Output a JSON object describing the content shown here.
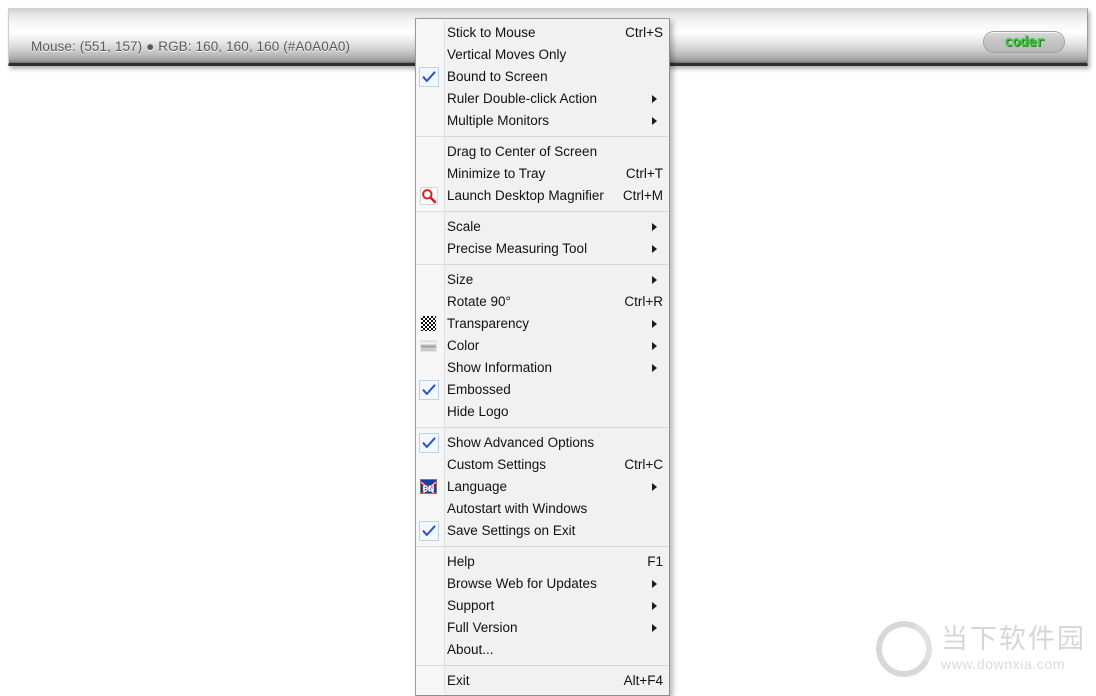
{
  "ruler": {
    "readout": "Mouse: (551, 157) ● RGB: 160, 160, 160 (#A0A0A0)",
    "logo_text": "coder"
  },
  "menu": {
    "groups": [
      {
        "items": [
          {
            "label": "Stick to Mouse",
            "shortcut": "Ctrl+S",
            "checked": false,
            "submenu": false,
            "icon": ""
          },
          {
            "label": "Vertical Moves Only",
            "shortcut": "",
            "checked": false,
            "submenu": false,
            "icon": ""
          },
          {
            "label": "Bound to Screen",
            "shortcut": "",
            "checked": true,
            "submenu": false,
            "icon": ""
          },
          {
            "label": "Ruler Double-click Action",
            "shortcut": "",
            "checked": false,
            "submenu": true,
            "icon": ""
          },
          {
            "label": "Multiple Monitors",
            "shortcut": "",
            "checked": false,
            "submenu": true,
            "icon": ""
          }
        ]
      },
      {
        "items": [
          {
            "label": "Drag to Center of Screen",
            "shortcut": "",
            "checked": false,
            "submenu": false,
            "icon": ""
          },
          {
            "label": "Minimize to Tray",
            "shortcut": "Ctrl+T",
            "checked": false,
            "submenu": false,
            "icon": ""
          },
          {
            "label": "Launch Desktop Magnifier",
            "shortcut": "Ctrl+M",
            "checked": false,
            "submenu": false,
            "icon": "magnifier-icon"
          }
        ]
      },
      {
        "items": [
          {
            "label": "Scale",
            "shortcut": "",
            "checked": false,
            "submenu": true,
            "icon": ""
          },
          {
            "label": "Precise Measuring Tool",
            "shortcut": "",
            "checked": false,
            "submenu": true,
            "icon": ""
          }
        ]
      },
      {
        "items": [
          {
            "label": "Size",
            "shortcut": "",
            "checked": false,
            "submenu": true,
            "icon": ""
          },
          {
            "label": "Rotate 90°",
            "shortcut": "Ctrl+R",
            "checked": false,
            "submenu": false,
            "icon": ""
          },
          {
            "label": "Transparency",
            "shortcut": "",
            "checked": false,
            "submenu": true,
            "icon": "transparency-icon"
          },
          {
            "label": "Color",
            "shortcut": "",
            "checked": false,
            "submenu": true,
            "icon": "color-gradient-icon"
          },
          {
            "label": "Show Information",
            "shortcut": "",
            "checked": false,
            "submenu": true,
            "icon": ""
          },
          {
            "label": "Embossed",
            "shortcut": "",
            "checked": true,
            "submenu": false,
            "icon": ""
          },
          {
            "label": "Hide Logo",
            "shortcut": "",
            "checked": false,
            "submenu": false,
            "icon": ""
          }
        ]
      },
      {
        "items": [
          {
            "label": "Show Advanced Options",
            "shortcut": "",
            "checked": true,
            "submenu": false,
            "icon": ""
          },
          {
            "label": "Custom Settings",
            "shortcut": "Ctrl+C",
            "checked": false,
            "submenu": false,
            "icon": ""
          },
          {
            "label": "Language",
            "shortcut": "",
            "checked": false,
            "submenu": true,
            "icon": "language-flag-icon"
          },
          {
            "label": "Autostart with Windows",
            "shortcut": "",
            "checked": false,
            "submenu": false,
            "icon": ""
          },
          {
            "label": "Save Settings on Exit",
            "shortcut": "",
            "checked": true,
            "submenu": false,
            "icon": ""
          }
        ]
      },
      {
        "items": [
          {
            "label": "Help",
            "shortcut": "F1",
            "checked": false,
            "submenu": false,
            "icon": ""
          },
          {
            "label": "Browse Web for Updates",
            "shortcut": "",
            "checked": false,
            "submenu": true,
            "icon": ""
          },
          {
            "label": "Support",
            "shortcut": "",
            "checked": false,
            "submenu": true,
            "icon": ""
          },
          {
            "label": "Full Version",
            "shortcut": "",
            "checked": false,
            "submenu": true,
            "icon": ""
          },
          {
            "label": "About...",
            "shortcut": "",
            "checked": false,
            "submenu": false,
            "icon": ""
          }
        ]
      },
      {
        "items": [
          {
            "label": "Exit",
            "shortcut": "Alt+F4",
            "checked": false,
            "submenu": false,
            "icon": ""
          }
        ]
      }
    ]
  },
  "watermark": {
    "name_cn": "当下软件园",
    "url": "www.downxia.com"
  },
  "colors": {
    "menu_background": "#f1f1f1",
    "menu_border": "#9a9a9a",
    "check_blue": "#2a4fd0",
    "logo_green": "#3ecb3e",
    "magnifier_red": "#d42020",
    "flag_blue": "#1b3fa0",
    "watermark_gray": "#b9b9b9"
  }
}
